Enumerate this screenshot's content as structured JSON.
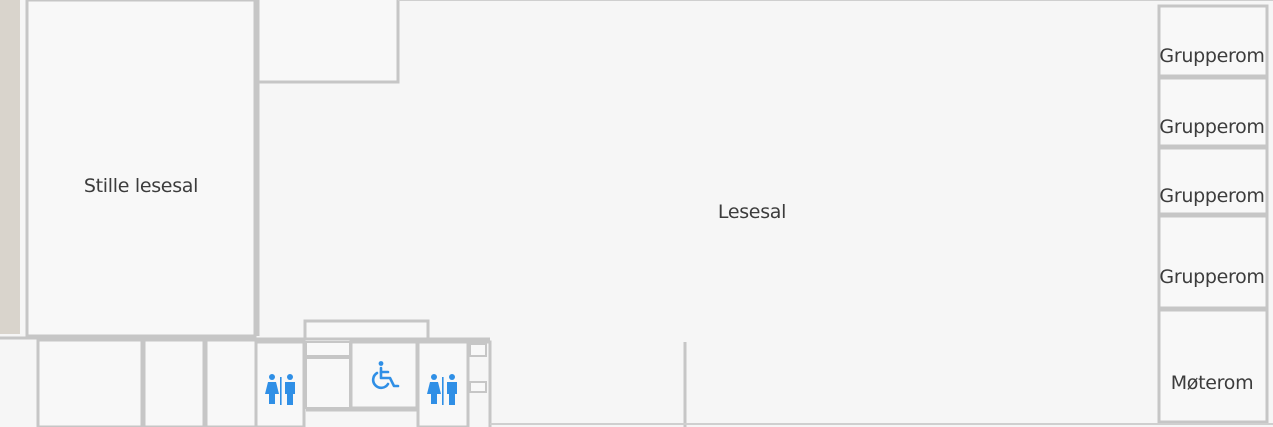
{
  "map": {
    "rooms": {
      "quiet_reading_room": "Stille lesesal",
      "reading_room": "Lesesal",
      "group_room_1": "Grupperom",
      "group_room_2": "Grupperom",
      "group_room_3": "Grupperom",
      "group_room_4": "Grupperom",
      "meeting_room": "Møterom"
    },
    "icons": {
      "toilet_left": "toilet-icon",
      "accessible_toilet": "wheelchair-icon",
      "toilet_right": "toilet-icon"
    },
    "colors": {
      "floor": "#f8f8f8",
      "wall": "#c8c8c8",
      "outside": "#d9d4cc",
      "icon": "#2f8fe6",
      "text": "#3c3c3c"
    }
  }
}
